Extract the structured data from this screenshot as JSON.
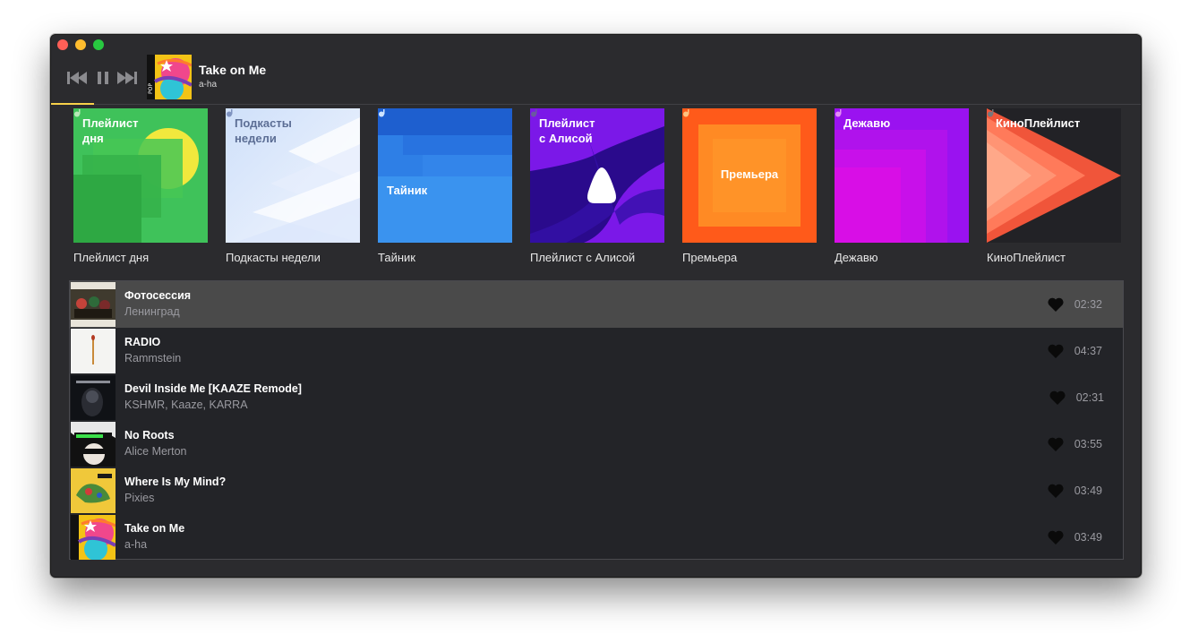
{
  "player": {
    "prev_icon": "previous-track-icon",
    "pause_icon": "pause-icon",
    "next_icon": "next-track-icon",
    "progress_fraction": 0.45,
    "now_playing": {
      "title": "Take on Me",
      "artist": "a-ha",
      "cover_tag": "POP"
    }
  },
  "playlists": [
    {
      "label": "Плейлист дня",
      "cover_title": "Плейлист\nдня"
    },
    {
      "label": "Подкасты недели",
      "cover_title": "Подкасты\nнедели"
    },
    {
      "label": "Тайник",
      "cover_title": "Тайник"
    },
    {
      "label": "Плейлист с Алисой",
      "cover_title": "Плейлист\nс Алисой"
    },
    {
      "label": "Премьера",
      "cover_title": "Премьера"
    },
    {
      "label": "Дежавю",
      "cover_title": "Дежавю"
    },
    {
      "label": "КиноПлейлист",
      "cover_title": "КиноПлейлист"
    }
  ],
  "tracks": [
    {
      "title": "Фотосессия",
      "artist": "Ленинград",
      "duration": "02:32",
      "active": true
    },
    {
      "title": "RADIO",
      "artist": "Rammstein",
      "duration": "04:37",
      "active": false
    },
    {
      "title": "Devil Inside Me  [KAAZE Remode]",
      "artist": "KSHMR, Kaaze, KARRA",
      "duration": "02:31",
      "active": false
    },
    {
      "title": "No Roots",
      "artist": "Alice Merton",
      "duration": "03:55",
      "active": false
    },
    {
      "title": "Where Is My Mind?",
      "artist": "Pixies",
      "duration": "03:49",
      "active": false
    },
    {
      "title": "Take on Me",
      "artist": "a-ha",
      "duration": "03:49",
      "active": false
    }
  ],
  "colors": {
    "accent": "#f7d14a",
    "window_bg": "#2b2b2e",
    "active_row": "#4a4a4a"
  }
}
